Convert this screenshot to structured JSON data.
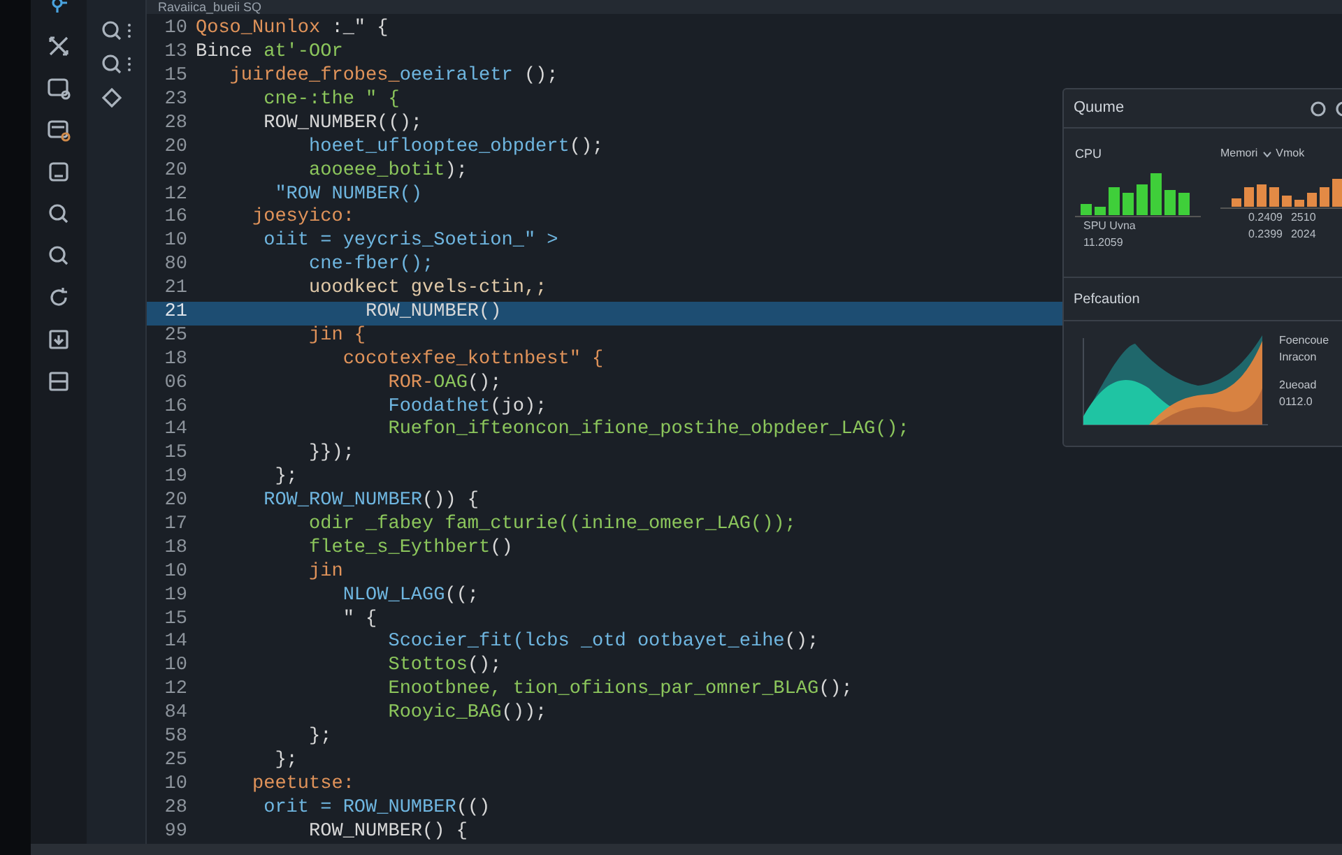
{
  "editor_title": "Ravaiica_bueii SQ",
  "code_lines": [
    {
      "number": "10",
      "selected": false,
      "segments": [
        {
          "text": "Qoso_Nunlox",
          "color": "#e0935a"
        },
        {
          "text": " :_\" {",
          "color": "#d8d8d8"
        }
      ]
    },
    {
      "number": "13",
      "selected": false,
      "segments": [
        {
          "text": "Bince ",
          "color": "#d8d8d8"
        },
        {
          "text": "at'-OOr",
          "color": "#8cc65c"
        }
      ]
    },
    {
      "number": "15",
      "selected": false,
      "segments": [
        {
          "text": "   juirdee_frobes_",
          "color": "#e0935a"
        },
        {
          "text": "oeeiraletr",
          "color": "#6fb6e0"
        },
        {
          "text": " ();",
          "color": "#d8d8d8"
        }
      ]
    },
    {
      "number": "23",
      "selected": false,
      "segments": [
        {
          "text": "      cne-:the \" {",
          "color": "#8cc65c"
        }
      ]
    },
    {
      "number": "28",
      "selected": false,
      "segments": [
        {
          "text": "      ROW_NUMBER(();",
          "color": "#d8d8d8"
        }
      ]
    },
    {
      "number": "20",
      "selected": false,
      "segments": [
        {
          "text": "          hoeet_uflooptee_obpdert",
          "color": "#6fb6e0"
        },
        {
          "text": "();",
          "color": "#d8d8d8"
        }
      ]
    },
    {
      "number": "20",
      "selected": false,
      "segments": [
        {
          "text": "          aooeee_botit",
          "color": "#8cc65c"
        },
        {
          "text": ");",
          "color": "#d8d8d8"
        }
      ]
    },
    {
      "number": "12",
      "selected": false,
      "segments": [
        {
          "text": "       \"ROW NUMBER()",
          "color": "#6fb6e0"
        }
      ]
    },
    {
      "number": "16",
      "selected": false,
      "segments": [
        {
          "text": "     joesyico:",
          "color": "#e0935a"
        }
      ]
    },
    {
      "number": "10",
      "selected": false,
      "segments": [
        {
          "text": "      oiit = yeycris_Soetion_\" >",
          "color": "#6fb6e0"
        }
      ]
    },
    {
      "number": "80",
      "selected": false,
      "segments": [
        {
          "text": "          cne-fber();",
          "color": "#6fb6e0"
        }
      ]
    },
    {
      "number": "21",
      "selected": false,
      "segments": [
        {
          "text": "          uoodkect gvels-ctin,;",
          "color": "#e0c9a8"
        }
      ]
    },
    {
      "number": "21",
      "selected": true,
      "segments": [
        {
          "text": "               ROW_NUMBER()",
          "color": "#d8d8d8"
        }
      ]
    },
    {
      "number": "25",
      "selected": false,
      "segments": [
        {
          "text": "          jin {",
          "color": "#e0935a"
        }
      ]
    },
    {
      "number": "18",
      "selected": false,
      "segments": [
        {
          "text": "             cocotexfee_kottnbest\" {",
          "color": "#e0935a"
        }
      ]
    },
    {
      "number": "06",
      "selected": false,
      "segments": [
        {
          "text": "                 ROR-",
          "color": "#e0935a"
        },
        {
          "text": "OAG",
          "color": "#8cc65c"
        },
        {
          "text": "();",
          "color": "#d8d8d8"
        }
      ]
    },
    {
      "number": "16",
      "selected": false,
      "segments": [
        {
          "text": "                 Foodathet",
          "color": "#6fb6e0"
        },
        {
          "text": "(jo);",
          "color": "#d8d8d8"
        }
      ]
    },
    {
      "number": "14",
      "selected": false,
      "segments": [
        {
          "text": "                 Ruefon_ifteoncon_ifione_postihe_obpdeer_LAG();",
          "color": "#8cc65c"
        }
      ]
    },
    {
      "number": "15",
      "selected": false,
      "segments": [
        {
          "text": "          }});",
          "color": "#d8d8d8"
        }
      ]
    },
    {
      "number": "19",
      "selected": false,
      "segments": [
        {
          "text": "       };",
          "color": "#d8d8d8"
        }
      ]
    },
    {
      "number": "20",
      "selected": false,
      "segments": [
        {
          "text": "      ROW_ROW_NUMBER",
          "color": "#6fb6e0"
        },
        {
          "text": "()) {",
          "color": "#d8d8d8"
        }
      ]
    },
    {
      "number": "17",
      "selected": false,
      "segments": [
        {
          "text": "          odir _fabey fam_cturie((inine_omeer_LAG());",
          "color": "#8cc65c"
        }
      ]
    },
    {
      "number": "18",
      "selected": false,
      "segments": [
        {
          "text": "          flete_s_Eythbert",
          "color": "#8cc65c"
        },
        {
          "text": "()",
          "color": "#d8d8d8"
        }
      ]
    },
    {
      "number": "10",
      "selected": false,
      "segments": [
        {
          "text": "          jin",
          "color": "#e0935a"
        }
      ]
    },
    {
      "number": "19",
      "selected": false,
      "segments": [
        {
          "text": "             NLOW_LAGG",
          "color": "#6fb6e0"
        },
        {
          "text": "((;",
          "color": "#d8d8d8"
        }
      ]
    },
    {
      "number": "15",
      "selected": false,
      "segments": [
        {
          "text": "             \" {",
          "color": "#d8d8d8"
        }
      ]
    },
    {
      "number": "14",
      "selected": false,
      "segments": [
        {
          "text": "                 Scocier_fit(lcbs _otd ootbayet_eihe",
          "color": "#6fb6e0"
        },
        {
          "text": "();",
          "color": "#d8d8d8"
        }
      ]
    },
    {
      "number": "10",
      "selected": false,
      "segments": [
        {
          "text": "                 Stottos",
          "color": "#8cc65c"
        },
        {
          "text": "();",
          "color": "#d8d8d8"
        }
      ]
    },
    {
      "number": "12",
      "selected": false,
      "segments": [
        {
          "text": "                 Enootbnee, tion_ofiions_par_omner_BLAG",
          "color": "#8cc65c"
        },
        {
          "text": "();",
          "color": "#d8d8d8"
        }
      ]
    },
    {
      "number": "84",
      "selected": false,
      "segments": [
        {
          "text": "                 Rooyic_BAG",
          "color": "#8cc65c"
        },
        {
          "text": "());",
          "color": "#d8d8d8"
        }
      ]
    },
    {
      "number": "58",
      "selected": false,
      "segments": [
        {
          "text": "          };",
          "color": "#d8d8d8"
        }
      ]
    },
    {
      "number": "25",
      "selected": false,
      "segments": [
        {
          "text": "       };",
          "color": "#d8d8d8"
        }
      ]
    },
    {
      "number": "10",
      "selected": false,
      "segments": [
        {
          "text": "     peetutse:",
          "color": "#e0935a"
        }
      ]
    },
    {
      "number": "28",
      "selected": false,
      "segments": [
        {
          "text": "      orit = ROW_NUMBER",
          "color": "#6fb6e0"
        },
        {
          "text": "(()",
          "color": "#d8d8d8"
        }
      ]
    },
    {
      "number": "99",
      "selected": false,
      "segments": [
        {
          "text": "          ROW_NUMBER() {",
          "color": "#d8d8d8"
        }
      ]
    }
  ],
  "monitor_panel": {
    "title": "Quume",
    "cpu": {
      "label": "CPU",
      "caption": "SPU Uvna",
      "value": "11.2059"
    },
    "memory": {
      "label": "Memori",
      "label_2": "Vmok",
      "rows": [
        [
          "0.2409",
          "2510"
        ],
        [
          "0.2399",
          "2024"
        ]
      ]
    },
    "performance": {
      "title": "Pefcaution",
      "legend": [
        "Foencoue",
        "Inracon",
        "2ueoad",
        "0112.0"
      ]
    }
  }
}
